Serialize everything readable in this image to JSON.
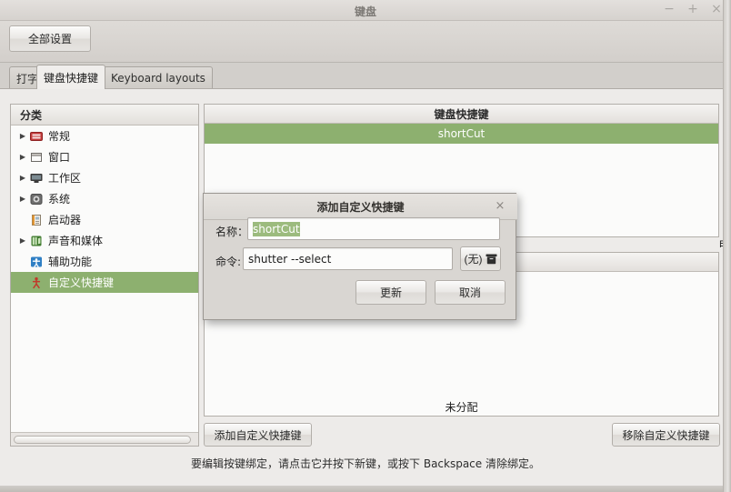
{
  "window": {
    "title": "键盘",
    "controls": [
      {
        "name": "minimize",
        "glyph": "−"
      },
      {
        "name": "maximize",
        "glyph": "+"
      },
      {
        "name": "close",
        "glyph": "×"
      }
    ]
  },
  "toolbar": {
    "all_settings_label": "全部设置"
  },
  "tabs": [
    {
      "label": "打字",
      "active": false
    },
    {
      "label": "键盘快捷键",
      "active": true
    },
    {
      "label": "Keyboard layouts",
      "active": false
    }
  ],
  "tree": {
    "header": "分类",
    "items": [
      {
        "label": "常规",
        "icon": "keyboard-icon",
        "icon_color": "#c43c3c",
        "expandable": true,
        "selected": false
      },
      {
        "label": "窗口",
        "icon": "window-icon",
        "icon_color": "#f4f3f0",
        "expandable": true,
        "selected": false
      },
      {
        "label": "工作区",
        "icon": "monitor-icon",
        "icon_color": "#3a3a3a",
        "expandable": true,
        "selected": false
      },
      {
        "label": "系统",
        "icon": "system-gear-icon",
        "icon_color": "#5a5a5a",
        "expandable": true,
        "selected": false
      },
      {
        "label": "启动器",
        "icon": "launcher-icon",
        "icon_color": "#e08a2a",
        "expandable": false,
        "selected": false
      },
      {
        "label": "声音和媒体",
        "icon": "sound-media-icon",
        "icon_color": "#4c8a34",
        "expandable": true,
        "selected": false
      },
      {
        "label": "辅助功能",
        "icon": "accessibility-icon",
        "icon_color": "#2f7fc4",
        "expandable": false,
        "selected": false
      },
      {
        "label": "自定义快捷键",
        "icon": "custom-shortcut-icon",
        "icon_color": "#c03a2b",
        "expandable": false,
        "selected": true
      }
    ]
  },
  "shortcuts_panel": {
    "header": "键盘快捷键",
    "rows": [
      {
        "label": "shortCut",
        "selected": true
      }
    ]
  },
  "bindings_panel": {
    "header": "",
    "rows": [
      {
        "label": "未分配",
        "selected": false
      }
    ]
  },
  "actions": {
    "add_label": "添加自定义快捷键",
    "remove_label": "移除自定义快捷键"
  },
  "hint": "要编辑按键绑定，请点击它并按下新键，或按下 Backspace 清除绑定。",
  "dialog": {
    "title": "添加自定义快捷键",
    "close_glyph": "×",
    "name_label": "名称：",
    "name_value": "shortCut",
    "name_placeholder": "",
    "command_label": "命令:",
    "command_value": "shutter --select",
    "command_placeholder": "",
    "none_label": "(无)",
    "update_label": "更新",
    "cancel_label": "取消"
  },
  "edge_sliver": "自",
  "colors": {
    "selection_green": "#8db06f",
    "text_selection_green": "#9cbb7e",
    "window_bg": "#d7d4d1",
    "panel_bg": "#fbfbfa"
  }
}
